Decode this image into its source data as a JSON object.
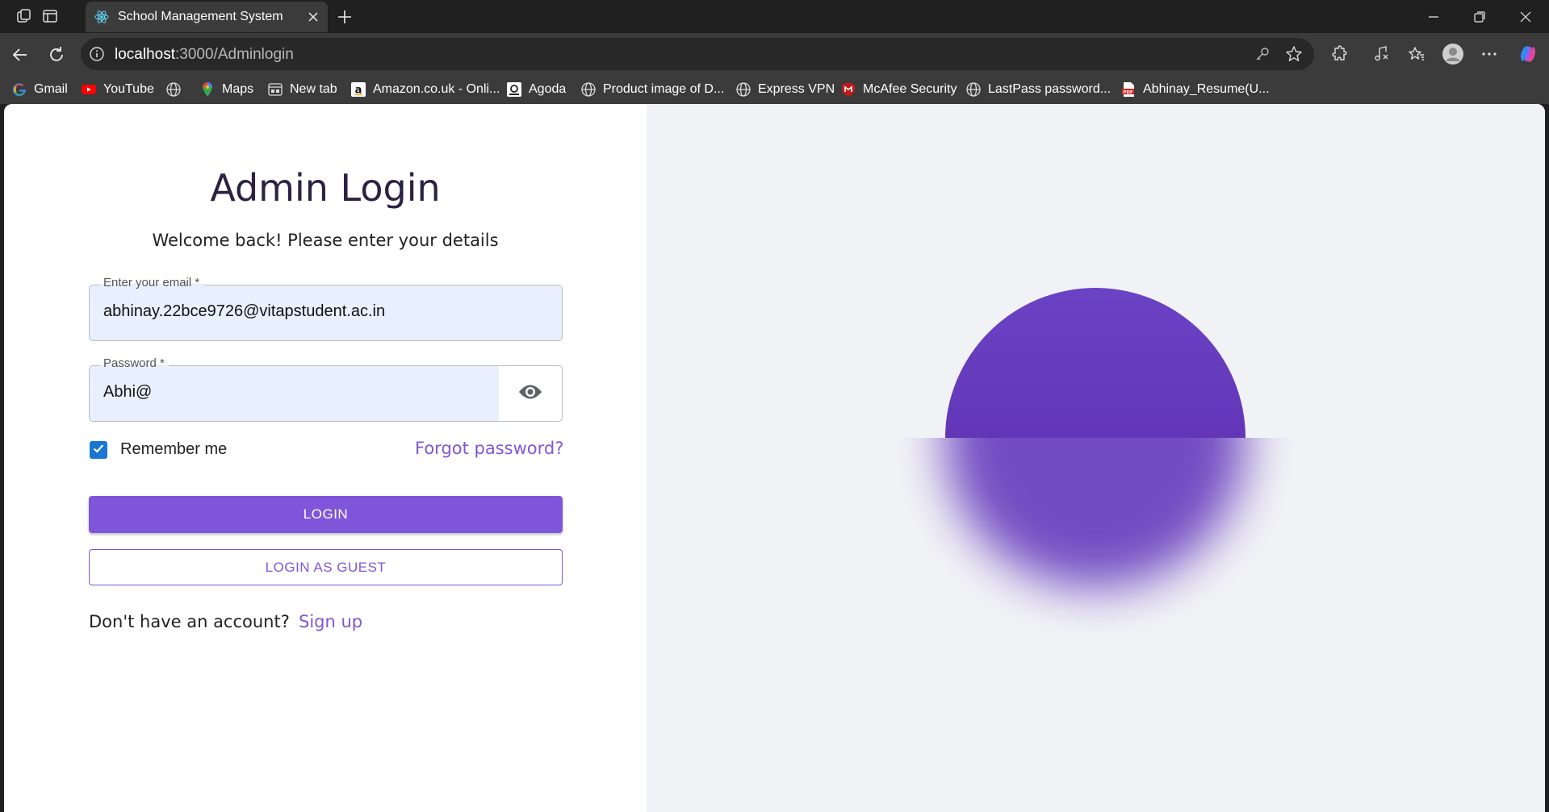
{
  "browser": {
    "tab_title": "School Management System",
    "url_host": "localhost",
    "url_path": ":3000/Adminlogin"
  },
  "bookmarks": [
    {
      "label": "Gmail",
      "icon": "google-icon"
    },
    {
      "label": "YouTube",
      "icon": "youtube-icon"
    },
    {
      "label": "",
      "icon": "globe-icon"
    },
    {
      "label": "Maps",
      "icon": "maps-icon"
    },
    {
      "label": "New tab",
      "icon": "newtab-icon"
    },
    {
      "label": "Amazon.co.uk - Onli...",
      "icon": "amazon-icon"
    },
    {
      "label": "Agoda",
      "icon": "agoda-icon"
    },
    {
      "label": "Product image of D...",
      "icon": "globe-icon"
    },
    {
      "label": "Express VPN",
      "icon": "globe-icon"
    },
    {
      "label": "McAfee Security",
      "icon": "mcafee-icon"
    },
    {
      "label": "LastPass password...",
      "icon": "globe-icon"
    },
    {
      "label": "Abhinay_Resume(U...",
      "icon": "pdf-icon"
    }
  ],
  "login": {
    "title": "Admin Login",
    "subtitle": "Welcome back! Please enter your details",
    "email_label": "Enter your email *",
    "email_value": "abhinay.22bce9726@vitapstudent.ac.in",
    "password_label": "Password *",
    "password_value": "Abhi@",
    "remember_label": "Remember me",
    "remember_checked": true,
    "forgot_label": "Forgot password?",
    "login_button": "LOGIN",
    "guest_button": "LOGIN AS GUEST",
    "no_account_text": "Don't have an account?",
    "signup_label": "Sign up"
  },
  "colors": {
    "accent": "#7f56d9",
    "checkbox": "#1976d2",
    "circle": "#6336b8",
    "right_panel_bg": "#f1f2f6"
  }
}
